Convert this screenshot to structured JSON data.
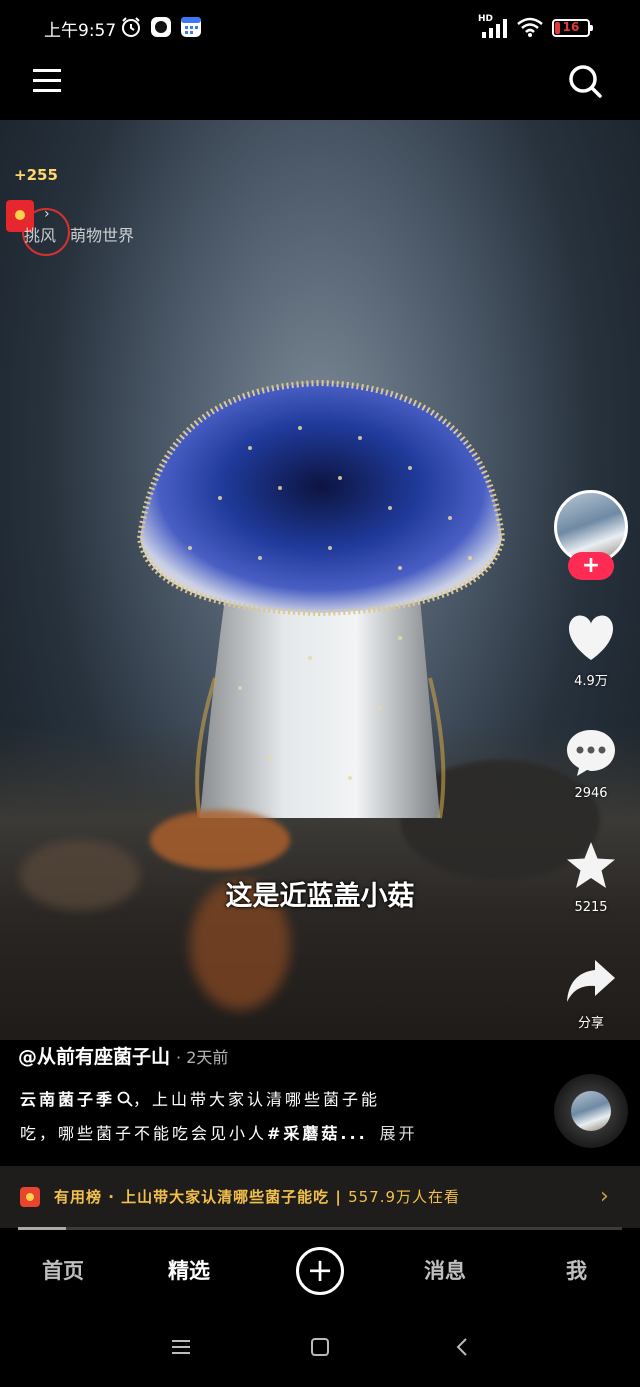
{
  "status_bar": {
    "time": "上午9:57",
    "network": "HD",
    "battery": "16",
    "battery_level": 0.16,
    "icons": [
      "alarm-icon",
      "circle-app-icon",
      "calendar-icon",
      "signal-icon",
      "wifi-icon",
      "battery-icon"
    ]
  },
  "top_bar": {
    "menu_icon": "hamburger-menu-icon",
    "search_icon": "search-icon"
  },
  "video": {
    "coin_reward": "+255",
    "tag_left": "挑风",
    "tag_right": "萌物世界",
    "caption": "这是近蓝盖小菇"
  },
  "right_rail": {
    "like_count": "4.9万",
    "comment_count": "2946",
    "favorite_count": "5215",
    "share_label": "分享"
  },
  "info": {
    "author": "@从前有座菌子山",
    "time_ago": "· 2天前",
    "desc_prefix": "云南菌子季",
    "desc_line1_rest": "，上山带大家认清哪些菌子能",
    "desc_line2": "吃，哪些菌子不能吃会见小人",
    "hashtag": "#采蘑菇...",
    "expand": "展开"
  },
  "banner": {
    "text": "有用榜 · 上山带大家认清哪些菌子能吃",
    "viewers": "557.9万人在看",
    "progress": 0.08
  },
  "bottom_nav": {
    "home": "首页",
    "featured": "精选",
    "add": "+",
    "messages": "消息",
    "me": "我"
  },
  "colors": {
    "accent": "#fe2c55",
    "banner_text": "#f3c04b",
    "battery_low": "#e23b3b"
  }
}
